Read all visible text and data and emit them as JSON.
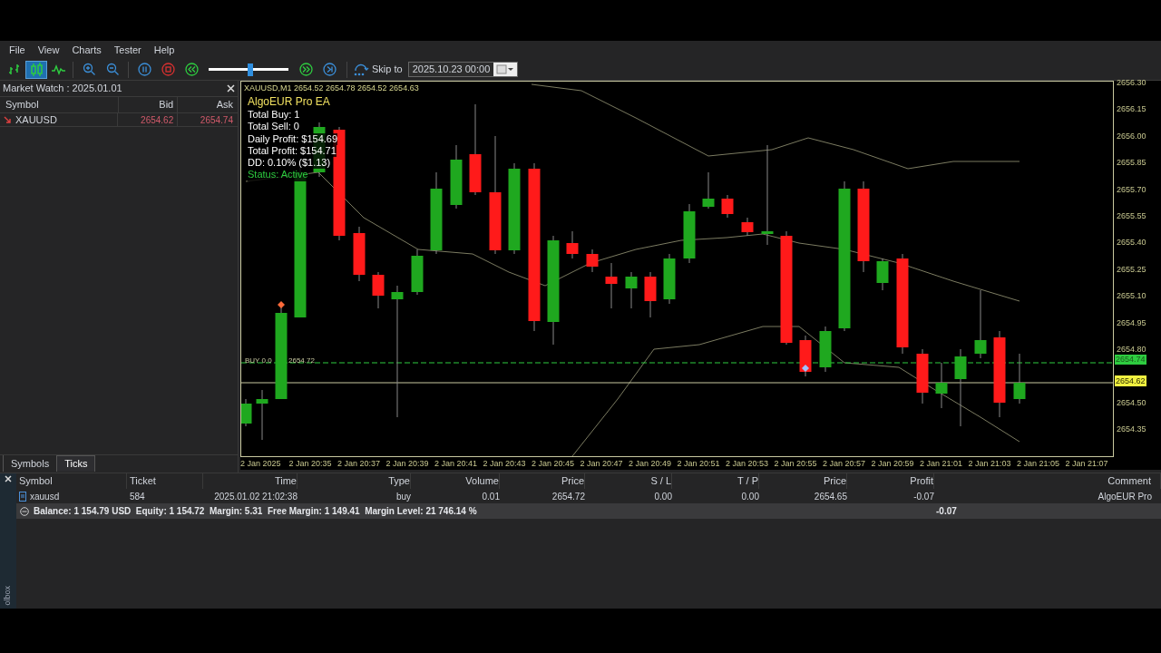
{
  "menu": [
    "File",
    "View",
    "Charts",
    "Tester",
    "Help"
  ],
  "toolbar": {
    "chart_types": [
      {
        "kind": "bars",
        "selected": false
      },
      {
        "kind": "candles",
        "selected": true
      },
      {
        "kind": "line",
        "selected": false
      }
    ],
    "speed_slider": {
      "level": 0.52
    },
    "skip_label": "Skip to",
    "skip_value": "2025.10.23 00:00"
  },
  "market_watch": {
    "title": "Market Watch : 2025.01.01",
    "columns": [
      "Symbol",
      "Bid",
      "Ask"
    ],
    "rows": [
      {
        "symbol": "XAUUSD",
        "bid": "2654.62",
        "ask": "2654.74"
      }
    ],
    "tabs": [
      {
        "label": "Symbols",
        "selected": false
      },
      {
        "label": "Ticks",
        "selected": true
      }
    ]
  },
  "chart": {
    "header": "XAUUSD,M1  2654.52 2654.78 2654.52 2654.63",
    "ea_title": "AlgoEUR Pro EA",
    "ea_lines": [
      "Total Buy: 1",
      "Total Sell: 0",
      "Daily Profit: $154.69",
      "Total Profit: $154.71",
      "DD: 0.10% ($1.13)"
    ],
    "ea_status": "Status: Active",
    "trade_label": "BUY 0.0",
    "trade_price": "2654.72",
    "price_ticks": [
      "2656.30",
      "2656.15",
      "2656.00",
      "2655.85",
      "2655.70",
      "2655.55",
      "2655.40",
      "2655.25",
      "2655.10",
      "2654.95",
      "2654.80",
      "2654.50",
      "2654.35"
    ],
    "ask_badge": "2654.74",
    "bid_badge": "2654.62",
    "time_ticks": [
      "2 Jan 2025",
      "2 Jan 20:35",
      "2 Jan 20:37",
      "2 Jan 20:39",
      "2 Jan 20:41",
      "2 Jan 20:43",
      "2 Jan 20:45",
      "2 Jan 20:47",
      "2 Jan 20:49",
      "2 Jan 20:51",
      "2 Jan 20:53",
      "2 Jan 20:55",
      "2 Jan 20:57",
      "2 Jan 20:59",
      "2 Jan 21:01",
      "2 Jan 21:03",
      "2 Jan 21:05",
      "2 Jan 21:07"
    ]
  },
  "trade_table": {
    "columns": [
      "Symbol",
      "Ticket",
      "Time",
      "Type",
      "Volume",
      "Price",
      "S / L",
      "T / P",
      "Price",
      "Profit",
      "Comment"
    ],
    "rows": [
      {
        "cells": [
          "xauusd",
          "584",
          "2025.01.02 21:02:38",
          "buy",
          "0.01",
          "2654.72",
          "0.00",
          "0.00",
          "2654.65",
          "-0.07",
          "AlgoEUR Pro"
        ]
      }
    ],
    "summary": "Balance: 1 154.79 USD  Equity: 1 154.72  Margin: 5.31  Free Margin: 1 149.41  Margin Level: 21 746.14 %",
    "summary_profit": "-0.07"
  },
  "side_label": "olbox"
}
